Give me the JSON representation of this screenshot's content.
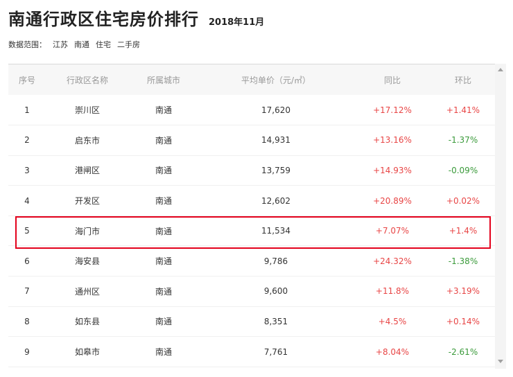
{
  "header": {
    "title": "南通行政区住宅房价排行",
    "date": "2018年11月"
  },
  "scope": {
    "label": "数据范围：",
    "tags": [
      "江苏",
      "南通",
      "住宅",
      "二手房"
    ]
  },
  "table": {
    "headers": [
      "序号",
      "行政区名称",
      "所属城市",
      "平均单价（元/㎡）",
      "同比",
      "环比"
    ],
    "rows": [
      {
        "rank": "1",
        "district": "崇川区",
        "city": "南通",
        "price": "17,620",
        "yoy": "+17.12%",
        "yoy_dir": "up",
        "mom": "+1.41%",
        "mom_dir": "up"
      },
      {
        "rank": "2",
        "district": "启东市",
        "city": "南通",
        "price": "14,931",
        "yoy": "+13.16%",
        "yoy_dir": "up",
        "mom": "-1.37%",
        "mom_dir": "down"
      },
      {
        "rank": "3",
        "district": "港闸区",
        "city": "南通",
        "price": "13,759",
        "yoy": "+14.93%",
        "yoy_dir": "up",
        "mom": "-0.09%",
        "mom_dir": "down"
      },
      {
        "rank": "4",
        "district": "开发区",
        "city": "南通",
        "price": "12,602",
        "yoy": "+20.89%",
        "yoy_dir": "up",
        "mom": "+0.02%",
        "mom_dir": "up"
      },
      {
        "rank": "5",
        "district": "海门市",
        "city": "南通",
        "price": "11,534",
        "yoy": "+7.07%",
        "yoy_dir": "up",
        "mom": "+1.4%",
        "mom_dir": "up"
      },
      {
        "rank": "6",
        "district": "海安县",
        "city": "南通",
        "price": "9,786",
        "yoy": "+24.32%",
        "yoy_dir": "up",
        "mom": "-1.38%",
        "mom_dir": "down"
      },
      {
        "rank": "7",
        "district": "通州区",
        "city": "南通",
        "price": "9,600",
        "yoy": "+11.8%",
        "yoy_dir": "up",
        "mom": "+3.19%",
        "mom_dir": "up"
      },
      {
        "rank": "8",
        "district": "如东县",
        "city": "南通",
        "price": "8,351",
        "yoy": "+4.5%",
        "yoy_dir": "up",
        "mom": "+0.14%",
        "mom_dir": "up"
      },
      {
        "rank": "9",
        "district": "如皋市",
        "city": "南通",
        "price": "7,761",
        "yoy": "+8.04%",
        "yoy_dir": "up",
        "mom": "-2.61%",
        "mom_dir": "down"
      }
    ]
  },
  "colors": {
    "up": "#e84545",
    "down": "#3a9a3a",
    "highlight": "#e3001b"
  }
}
